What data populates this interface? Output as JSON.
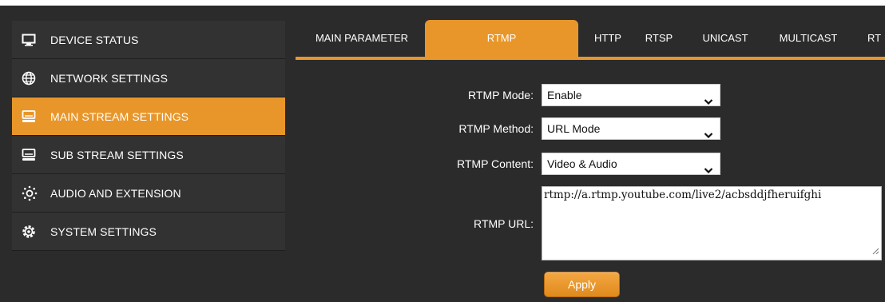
{
  "sidebar": {
    "items": [
      {
        "label": "DEVICE STATUS",
        "icon": "monitor-icon",
        "active": false
      },
      {
        "label": "NETWORK SETTINGS",
        "icon": "globe-icon",
        "active": false
      },
      {
        "label": "MAIN STREAM SETTINGS",
        "icon": "hard-drive-icon",
        "active": true
      },
      {
        "label": "SUB STREAM SETTINGS",
        "icon": "hard-drive-icon",
        "active": false
      },
      {
        "label": "AUDIO AND EXTENSION",
        "icon": "sun-icon",
        "active": false
      },
      {
        "label": "SYSTEM SETTINGS",
        "icon": "gear-icon",
        "active": false
      }
    ]
  },
  "tabs": [
    {
      "label": "MAIN PARAMETER",
      "active": false
    },
    {
      "label": "RTMP",
      "active": true
    },
    {
      "label": "HTTP",
      "active": false
    },
    {
      "label": "RTSP",
      "active": false
    },
    {
      "label": "UNICAST",
      "active": false
    },
    {
      "label": "MULTICAST",
      "active": false
    },
    {
      "label": "RT",
      "active": false
    }
  ],
  "form": {
    "rtmp_mode": {
      "label": "RTMP Mode:",
      "value": "Enable"
    },
    "rtmp_method": {
      "label": "RTMP Method:",
      "value": "URL Mode"
    },
    "rtmp_content": {
      "label": "RTMP Content:",
      "value": "Video & Audio"
    },
    "rtmp_url": {
      "label": "RTMP URL:",
      "value": "rtmp://a.rtmp.youtube.com/live2/acbsddjfheruifghi"
    },
    "apply_label": "Apply"
  },
  "colors": {
    "accent": "#e8962a",
    "background": "#2b2b2b",
    "sidebar_item": "#323232"
  }
}
